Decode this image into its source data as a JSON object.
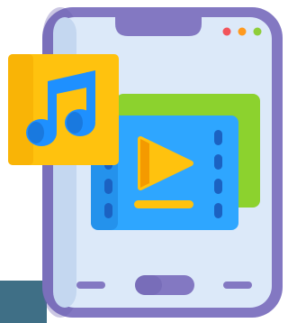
{
  "illustration": {
    "subject": "media-app-phone",
    "icons": [
      "music-note-icon",
      "play-icon",
      "film-strip-icon"
    ]
  },
  "palette": {
    "phone_frame": "#8378c2",
    "phone_frame_dark": "#6b5fb0",
    "screen": "#dce9f9",
    "screen_shadow": "#c4d7f0",
    "notch": "#8378c2",
    "dot_red": "#f2545b",
    "dot_orange": "#ff9a1f",
    "dot_green": "#8fce3a",
    "music_card": "#ffc20e",
    "music_card_dark": "#f4a900",
    "music_note": "#1e90ff",
    "music_note_dark": "#1666c5",
    "video_back": "#8cd22e",
    "video_front": "#2ea6ff",
    "video_front_dark": "#1979d4",
    "film_holes": "#1b62c2",
    "play": "#ffc20e",
    "play_dark": "#f49a00",
    "progress": "#ffc20e",
    "bottom_bar": "#8378c2",
    "background_strip": "#3f6f86"
  }
}
